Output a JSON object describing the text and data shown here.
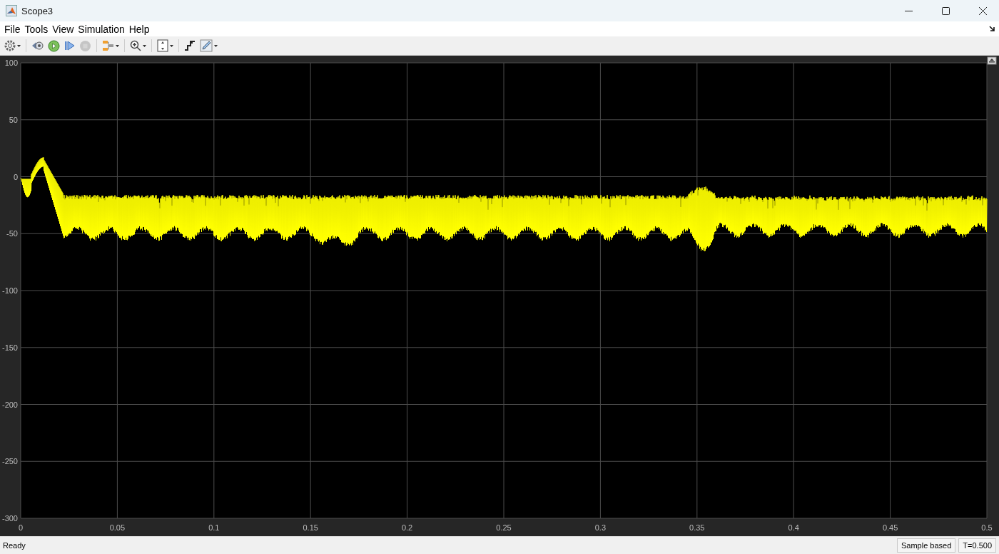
{
  "window": {
    "title": "Scope3"
  },
  "menu": [
    "File",
    "Tools",
    "View",
    "Simulation",
    "Help"
  ],
  "toolbar": [
    {
      "kind": "settings",
      "has_menu": true,
      "disabled": false
    },
    {
      "kind": "step-back",
      "has_menu": false,
      "disabled": false
    },
    {
      "kind": "run",
      "has_menu": false,
      "disabled": false
    },
    {
      "kind": "step-forward",
      "has_menu": false,
      "disabled": false
    },
    {
      "kind": "stop",
      "has_menu": false,
      "disabled": true
    },
    {
      "kind": "highlight",
      "has_menu": true,
      "disabled": false
    },
    {
      "kind": "zoom",
      "has_menu": true,
      "disabled": false
    },
    {
      "kind": "scale",
      "has_menu": true,
      "disabled": false
    },
    {
      "kind": "triggers",
      "has_menu": false,
      "disabled": false
    },
    {
      "kind": "style",
      "has_menu": true,
      "disabled": false
    }
  ],
  "plot": {
    "y_ticks": [
      "100",
      "50",
      "0",
      "-50",
      "-100",
      "-150",
      "-200",
      "-250",
      "-300"
    ],
    "x_ticks": [
      "0",
      "0.05",
      "0.1",
      "0.15",
      "0.2",
      "0.25",
      "0.3",
      "0.35",
      "0.4",
      "0.45",
      "0.5"
    ]
  },
  "status_bar": {
    "message": "Ready",
    "mode": "Sample based",
    "time": "T=0.500"
  }
}
